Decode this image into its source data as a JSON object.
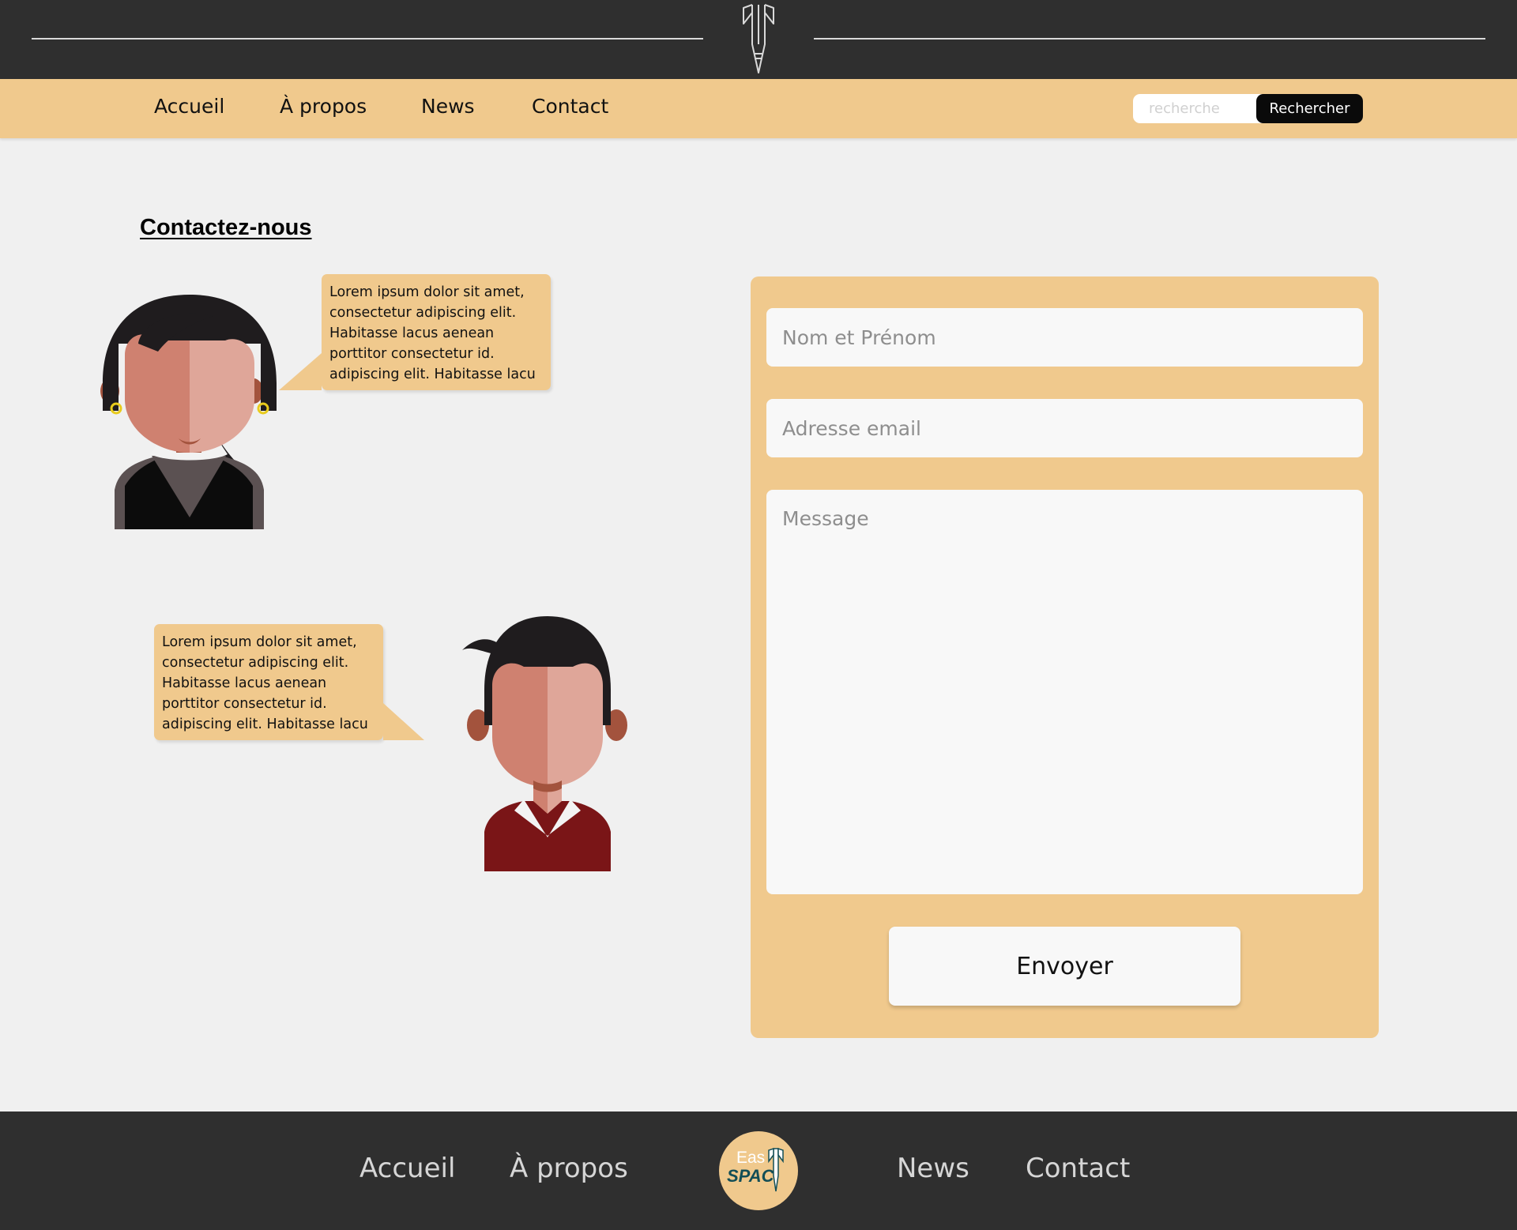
{
  "header": {
    "logo_icon": "rocket-icon"
  },
  "nav": {
    "items": [
      {
        "label": "Accueil"
      },
      {
        "label": "À propos"
      },
      {
        "label": "News"
      },
      {
        "label": "Contact"
      }
    ],
    "search": {
      "placeholder": "recherche",
      "value": "",
      "button_label": "Rechercher"
    }
  },
  "main": {
    "title": "Contactez-nous",
    "bubbles": [
      {
        "text": "Lorem ipsum dolor sit amet, consectetur adipiscing elit. Habitasse lacus aenean porttitor consectetur id. adipiscing elit. Habitasse lacu"
      },
      {
        "text": "Lorem ipsum dolor sit amet, consectetur adipiscing elit. Habitasse lacus aenean porttitor consectetur id. adipiscing elit. Habitasse lacu"
      }
    ],
    "avatars": [
      {
        "icon": "woman-avatar-icon"
      },
      {
        "icon": "man-avatar-icon"
      }
    ]
  },
  "form": {
    "name_placeholder": "Nom et Prénom",
    "name_value": "",
    "email_placeholder": "Adresse email",
    "email_value": "",
    "message_placeholder": "Message",
    "message_value": "",
    "submit_label": "Envoyer"
  },
  "footer": {
    "items": [
      {
        "label": "Accueil"
      },
      {
        "label": "À propos"
      },
      {
        "label": "News"
      },
      {
        "label": "Contact"
      }
    ],
    "logo": {
      "line1": "Eas",
      "line2": "SPAC",
      "icon": "rocket-icon"
    }
  },
  "colors": {
    "dark": "#2f2f2f",
    "accent": "#f0c98d",
    "page_bg": "#f0f0f0",
    "field_bg": "#f8f8f8",
    "button_dark": "#0a0a0a",
    "logo_teal": "#134e56"
  }
}
